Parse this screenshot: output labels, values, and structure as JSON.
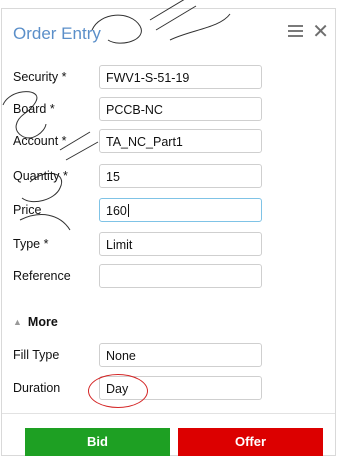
{
  "panel": {
    "title": "Order Entry",
    "menu_icon": "hamburger-menu-icon",
    "close_icon": "close-icon"
  },
  "fields": {
    "security": {
      "label": "Security *",
      "value": "FWV1-S-51-19"
    },
    "board": {
      "label": "Board *",
      "value": "PCCB-NC"
    },
    "account": {
      "label": "Account *",
      "value": "TA_NC_Part1"
    },
    "quantity": {
      "label": "Quantity *",
      "value": "15"
    },
    "price": {
      "label": "Price",
      "value": "160"
    },
    "type": {
      "label": "Type *",
      "value": "Limit"
    },
    "reference": {
      "label": "Reference",
      "value": ""
    }
  },
  "more": {
    "label": "More",
    "icon": "triangle-up-icon"
  },
  "extra": {
    "fill_type": {
      "label": "Fill Type",
      "value": "None"
    },
    "duration": {
      "label": "Duration",
      "value": "Day"
    }
  },
  "buttons": {
    "bid": "Bid",
    "offer": "Offer"
  },
  "colors": {
    "title": "#5b8fc9",
    "bid": "#1ea023",
    "offer": "#dc0000",
    "highlight": "#d42525",
    "focus": "#7fc3e6"
  }
}
